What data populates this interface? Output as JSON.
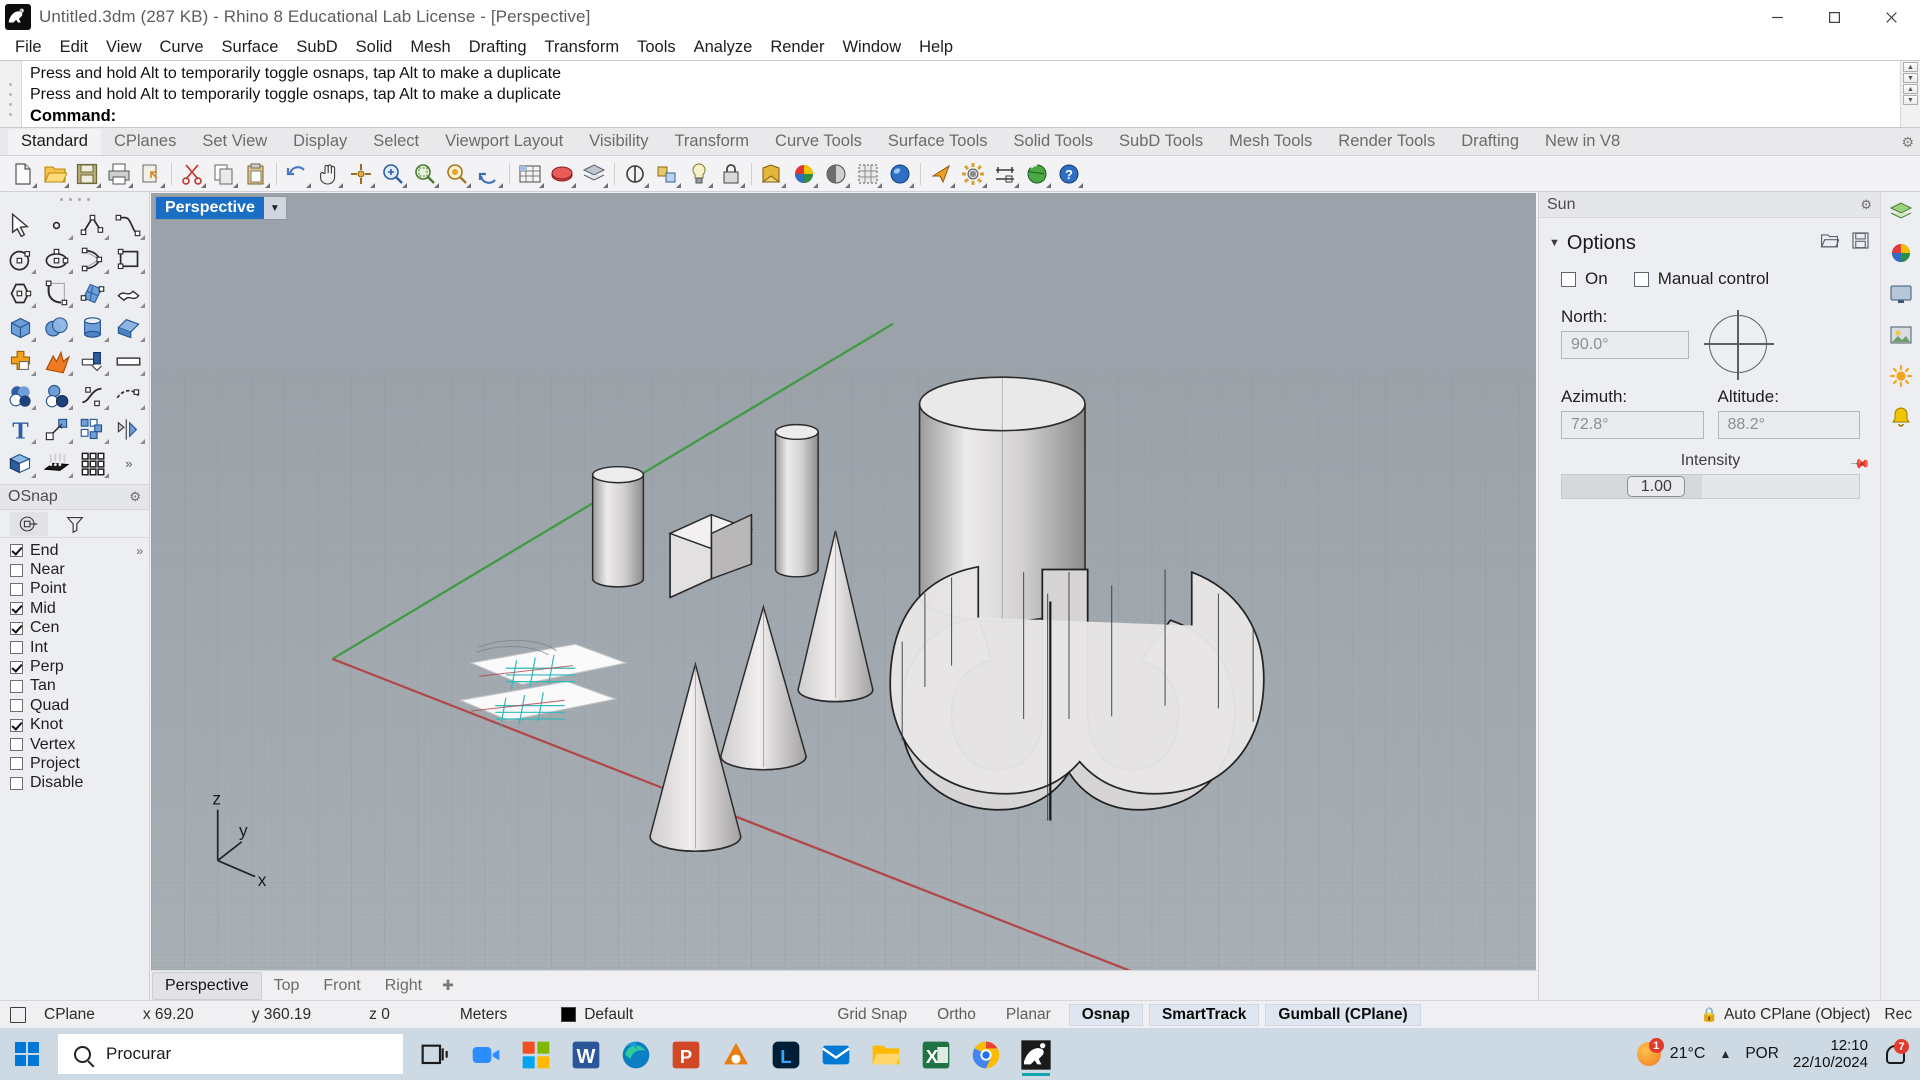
{
  "window": {
    "title": "Untitled.3dm (287 KB) - Rhino 8 Educational Lab License - [Perspective]",
    "minimize": "–",
    "maximize": "❐",
    "close": "✕"
  },
  "menubar": {
    "items": [
      "File",
      "Edit",
      "View",
      "Curve",
      "Surface",
      "SubD",
      "Solid",
      "Mesh",
      "Drafting",
      "Transform",
      "Tools",
      "Analyze",
      "Render",
      "Window",
      "Help"
    ]
  },
  "command": {
    "history": [
      "Press and hold Alt to temporarily toggle osnaps, tap Alt to make a duplicate",
      "Press and hold Alt to temporarily toggle osnaps, tap Alt to make a duplicate"
    ],
    "prompt": "Command:",
    "input_value": ""
  },
  "ribbon": {
    "tabs": [
      "Standard",
      "CPlanes",
      "Set View",
      "Display",
      "Select",
      "Viewport Layout",
      "Visibility",
      "Transform",
      "Curve Tools",
      "Surface Tools",
      "Solid Tools",
      "SubD Tools",
      "Mesh Tools",
      "Render Tools",
      "Drafting",
      "New in V8"
    ],
    "active_tab": "Standard",
    "gear_icon": "gear-icon"
  },
  "main_toolbar": {
    "icons": [
      "new-file-icon",
      "open-folder-icon",
      "save-icon",
      "print-icon",
      "copy-to-clipboard-icon",
      "cut-icon",
      "copy-icon",
      "paste-icon",
      "undo-icon",
      "pan-icon",
      "rotate-view-icon",
      "zoom-in-icon",
      "zoom-window-icon",
      "zoom-extents-icon",
      "zoom-selected-icon",
      "undo-view-icon",
      "grid-icon",
      "named-views-icon",
      "layers-icon",
      "hide-objects-icon",
      "show-objects-icon",
      "lock-icon",
      "unlock-icon",
      "layer-color-icon",
      "color-wheel-icon",
      "render-preview-icon",
      "render-mesh-icon",
      "sphere-render-icon",
      "light-icon",
      "gear-options-icon",
      "dimension-icon",
      "earth-render-icon",
      "help-icon"
    ]
  },
  "left_toolbar": {
    "grip": "toolbar-grip",
    "tools": [
      "select-arrow-icon",
      "point-icon",
      "polyline-icon",
      "curve-icon",
      "circle-icon",
      "ellipse-icon",
      "arc-icon",
      "rectangle-icon",
      "polygon-icon",
      "fillet-curve-icon",
      "surface-from-curves-icon",
      "surface-patch-icon",
      "box-icon",
      "sphere-boolean-icon",
      "cylinder-icon",
      "extrude-surface-icon",
      "boolean-union-icon",
      "explode-icon",
      "offset-surface-icon",
      "plane-icon",
      "boolean-difference-icon",
      "boolean-split-icon",
      "blend-curve-icon",
      "dash-curve-icon",
      "text-icon",
      "scale-icon",
      "array-icon",
      "mirror-icon",
      "solid-tools-icon",
      "extrude-points-icon",
      "grid-array-icon",
      "more-tools-icon"
    ]
  },
  "osnap": {
    "title": "OSnap",
    "gear_icon": "gear-icon",
    "tab_icons": [
      "osnap-target-icon",
      "filter-funnel-icon"
    ],
    "active_tab_index": 0,
    "more_icon": "chevron-double-right-icon",
    "items": [
      {
        "label": "End",
        "checked": true
      },
      {
        "label": "Near",
        "checked": false
      },
      {
        "label": "Point",
        "checked": false
      },
      {
        "label": "Mid",
        "checked": true
      },
      {
        "label": "Cen",
        "checked": true
      },
      {
        "label": "Int",
        "checked": false
      },
      {
        "label": "Perp",
        "checked": true
      },
      {
        "label": "Tan",
        "checked": false
      },
      {
        "label": "Quad",
        "checked": false
      },
      {
        "label": "Knot",
        "checked": true
      },
      {
        "label": "Vertex",
        "checked": false
      },
      {
        "label": "Project",
        "checked": false
      },
      {
        "label": "Disable",
        "checked": false
      }
    ]
  },
  "viewport": {
    "label": "Perspective",
    "dropdown_icon": "chevron-down-icon",
    "axis_labels": {
      "x": "x",
      "y": "y",
      "z": "z"
    },
    "tabs": [
      "Perspective",
      "Top",
      "Front",
      "Right"
    ],
    "active_tab": "Perspective",
    "add_tab_icon": "add-viewport-icon"
  },
  "right_panel": {
    "title": "Sun",
    "gear_icon": "gear-icon",
    "section": {
      "chevron_icon": "chevron-down-icon",
      "title": "Options",
      "open_icon": "open-folder-icon",
      "save_icon": "save-icon"
    },
    "on_checkbox": {
      "label": "On",
      "checked": false
    },
    "manual_checkbox": {
      "label": "Manual control",
      "checked": false
    },
    "north": {
      "label": "North:",
      "value": "90.0°"
    },
    "compass_icon": "compass-dial-icon",
    "azimuth": {
      "label": "Azimuth:",
      "value": "72.8°"
    },
    "altitude": {
      "label": "Altitude:",
      "value": "88.2°"
    },
    "intensity": {
      "label": "Intensity",
      "value": "1.00",
      "pin_icon": "pin-icon"
    }
  },
  "right_rail": {
    "icons": [
      "layers-panel-icon",
      "materials-panel-icon",
      "display-panel-icon",
      "render-panel-icon",
      "sun-panel-icon",
      "notifications-panel-icon"
    ]
  },
  "statusbar": {
    "cplane_icon": "cplane-icon",
    "cplane": "CPlane",
    "x": "x 69.20",
    "y": "y 360.19",
    "z": "z 0",
    "units": "Meters",
    "layer_swatch_color": "#000000",
    "layer": "Default",
    "toggles": [
      {
        "label": "Grid Snap",
        "on": false
      },
      {
        "label": "Ortho",
        "on": false
      },
      {
        "label": "Planar",
        "on": false
      },
      {
        "label": "Osnap",
        "on": true
      },
      {
        "label": "SmartTrack",
        "on": true
      },
      {
        "label": "Gumball (CPlane)",
        "on": true
      }
    ],
    "lock_icon": "lock-icon",
    "auto_cplane": "Auto CPlane (Object)",
    "record": "Rec"
  },
  "taskbar": {
    "start_icon": "windows-start-icon",
    "search": {
      "icon": "search-icon",
      "placeholder": "Procurar",
      "value": "Procurar"
    },
    "taskview_icon": "task-view-icon",
    "apps": [
      "zoom-icon",
      "microsoft-store-icon",
      "word-icon",
      "edge-icon",
      "powerpoint-icon",
      "blender-icon",
      "lightroom-icon",
      "mail-icon",
      "file-explorer-icon",
      "excel-icon",
      "chrome-icon",
      "rhino-icon"
    ],
    "active_app": "rhino-icon",
    "weather": {
      "icon": "sun-icon",
      "badge": "1",
      "temperature": "21°C"
    },
    "chevron_icon": "chevron-up-icon",
    "language": "POR",
    "time": "12:10",
    "date": "22/10/2024",
    "notifications": {
      "icon": "bell-icon",
      "count": "7"
    }
  }
}
